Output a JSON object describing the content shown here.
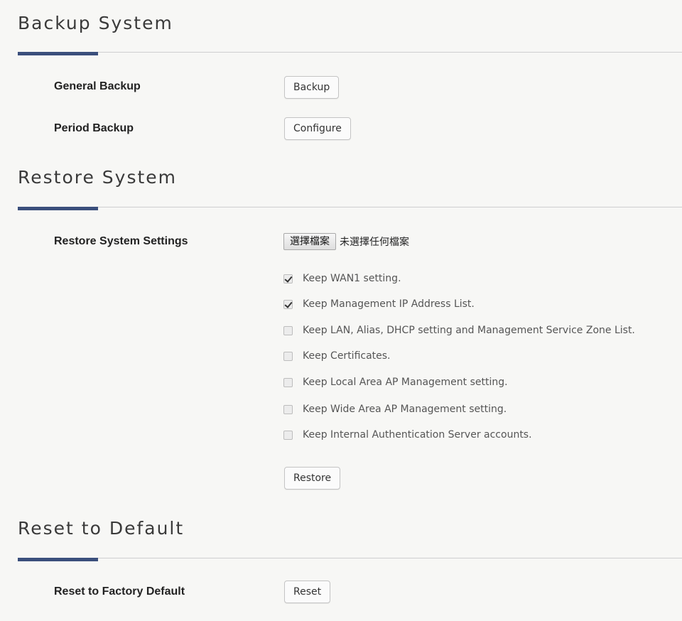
{
  "backup": {
    "title": "Backup System",
    "rows": [
      {
        "label": "General Backup",
        "button": "Backup"
      },
      {
        "label": "Period Backup",
        "button": "Configure"
      }
    ]
  },
  "restore": {
    "title": "Restore System",
    "label": "Restore System Settings",
    "file_button": "選擇檔案",
    "file_status": "未選擇任何檔案",
    "options": [
      {
        "label": "Keep WAN1 setting.",
        "checked": true
      },
      {
        "label": "Keep Management IP Address List.",
        "checked": true
      },
      {
        "label": "Keep LAN, Alias, DHCP setting and Management Service Zone List.",
        "checked": false
      },
      {
        "label": "Keep Certificates.",
        "checked": false
      },
      {
        "label": "Keep Local Area AP Management setting.",
        "checked": false
      },
      {
        "label": "Keep Wide Area AP Management setting.",
        "checked": false
      },
      {
        "label": "Keep Internal Authentication Server accounts.",
        "checked": false
      }
    ],
    "button": "Restore"
  },
  "reset": {
    "title": "Reset to Default",
    "label": "Reset to Factory Default",
    "button": "Reset"
  },
  "colors": {
    "accent": "#3b4f7c",
    "background": "#f7f7f5"
  }
}
